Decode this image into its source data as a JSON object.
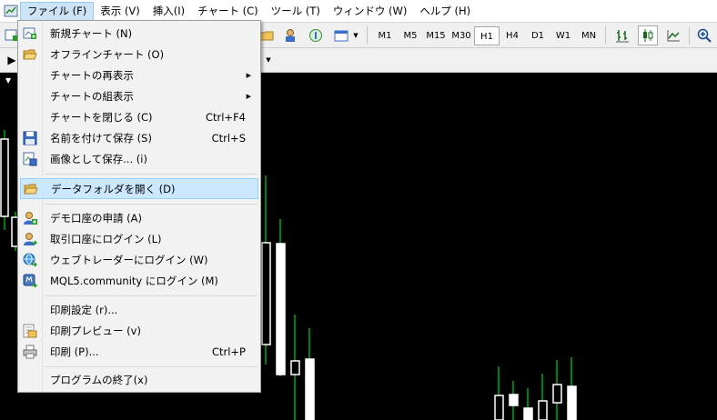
{
  "menubar": {
    "items": [
      "ファイル (F)",
      "表示 (V)",
      "挿入(I)",
      "チャート (C)",
      "ツール (T)",
      "ウィンドウ (W)",
      "ヘルプ (H)"
    ]
  },
  "toolbar": {
    "timeframes": [
      "M1",
      "M5",
      "M15",
      "M30",
      "H1",
      "H4",
      "D1",
      "W1",
      "MN"
    ],
    "active_timeframe": "H1"
  },
  "file_menu": {
    "items": [
      {
        "label": "新規チャート (N)",
        "icon": "new-chart-icon"
      },
      {
        "label": "オフラインチャート (O)",
        "icon": "open-folder-icon"
      },
      {
        "label": "チャートの再表示",
        "submenu": true
      },
      {
        "label": "チャートの組表示",
        "submenu": true
      },
      {
        "label": "チャートを閉じる (C)",
        "shortcut": "Ctrl+F4"
      },
      {
        "label": "名前を付けて保存 (S)",
        "shortcut": "Ctrl+S",
        "icon": "save-icon"
      },
      {
        "label": "画像として保存... (i)",
        "icon": "save-image-icon"
      },
      {
        "label": "データフォルダを開く (D)",
        "icon": "folder-icon",
        "highlighted": true
      },
      {
        "label": "デモ口座の申請 (A)",
        "icon": "demo-account-icon"
      },
      {
        "label": "取引口座にログイン (L)",
        "icon": "login-icon"
      },
      {
        "label": "ウェブトレーダーにログイン (W)",
        "icon": "webtrader-icon"
      },
      {
        "label": "MQL5.community にログイン (M)",
        "icon": "mql5-icon"
      },
      {
        "label": "印刷設定 (r)..."
      },
      {
        "label": "印刷プレビュー (v)",
        "icon": "print-preview-icon"
      },
      {
        "label": "印刷 (P)...",
        "shortcut": "Ctrl+P",
        "icon": "printer-icon"
      },
      {
        "label": "プログラムの終了(x)"
      }
    ]
  },
  "colors": {
    "chart_bg": "#000000",
    "candle": "#ffffff",
    "wick": "#00ff00",
    "highlight": "#cce8ff"
  }
}
